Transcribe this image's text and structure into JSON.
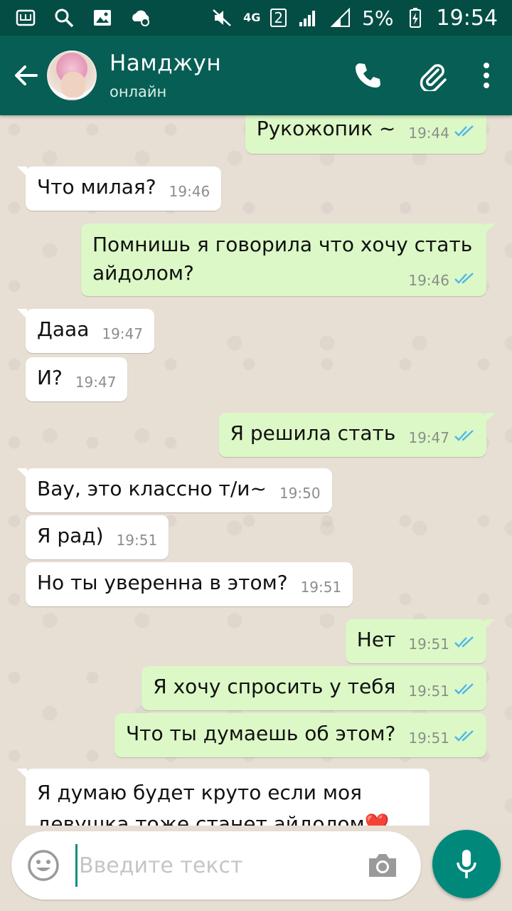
{
  "status_bar": {
    "signal_label": "4G",
    "sim_label": "2",
    "battery": "5%",
    "time": "19:54",
    "icons": [
      "sim-app-icon",
      "search-icon",
      "image-icon",
      "cloud-settings-icon",
      "mute-icon",
      "signal-icon",
      "battery-icon"
    ]
  },
  "header": {
    "name": "Намджун",
    "status": "онлайн",
    "icons": [
      "back-arrow-icon",
      "phone-icon",
      "attachment-icon",
      "more-vert-icon"
    ]
  },
  "messages": [
    {
      "dir": "out",
      "text": "Рукожопик ~",
      "time": "19:44"
    },
    {
      "dir": "in",
      "text": "Что милая?",
      "time": "19:46"
    },
    {
      "dir": "out",
      "text": "Помнишь я говорила что хочу стать айдолом?",
      "time": "19:46"
    },
    {
      "dir": "in",
      "text": "Дааа",
      "time": "19:47"
    },
    {
      "dir": "in",
      "text": "И?",
      "time": "19:47"
    },
    {
      "dir": "out",
      "text": "Я решила стать",
      "time": "19:47"
    },
    {
      "dir": "in",
      "text": "Вау, это классно т/и~",
      "time": "19:50"
    },
    {
      "dir": "in",
      "text": "Я рад)",
      "time": "19:51"
    },
    {
      "dir": "in",
      "text": "Но ты уверенна в этом?",
      "time": "19:51"
    },
    {
      "dir": "out",
      "text": "Нет",
      "time": "19:51"
    },
    {
      "dir": "out",
      "text": "Я хочу спросить у тебя",
      "time": "19:51"
    },
    {
      "dir": "out",
      "text": "Что ты думаешь об этом?",
      "time": "19:51"
    },
    {
      "dir": "in",
      "text": "Я думаю будет круто если моя девушка тоже станет айдолом❤️",
      "time": ""
    }
  ],
  "input": {
    "placeholder": "Введите текст"
  },
  "colors": {
    "header": "#075e54",
    "status_bar": "#044d45",
    "outgoing_bubble": "#dcf8c6",
    "incoming_bubble": "#ffffff",
    "read_ticks": "#4fb6ec",
    "mic_button": "#00897b"
  }
}
